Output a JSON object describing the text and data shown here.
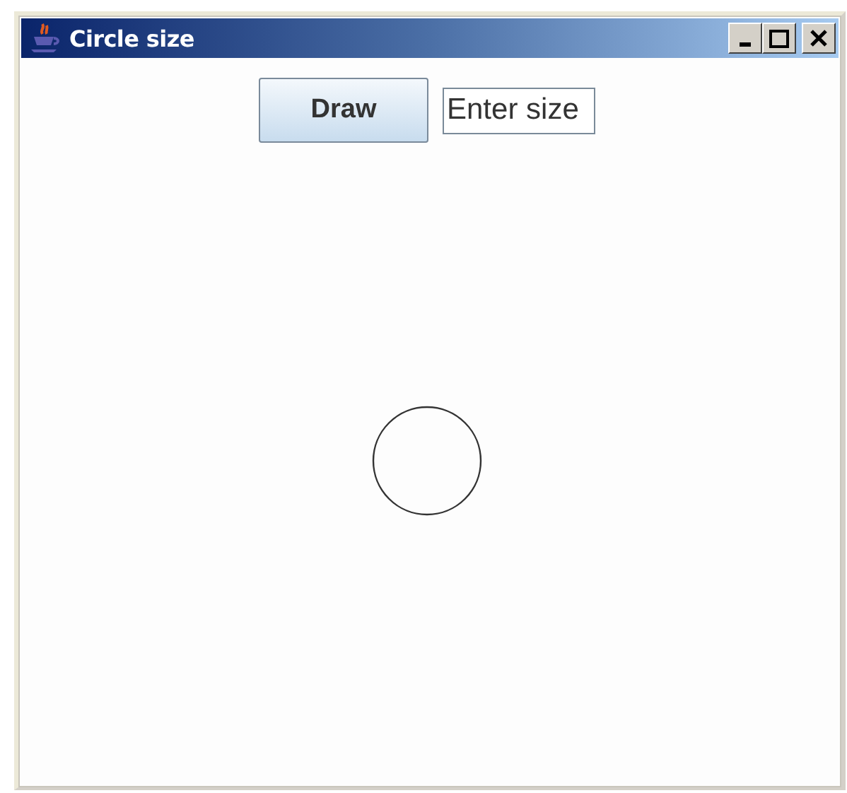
{
  "window": {
    "title": "Circle size"
  },
  "toolbar": {
    "button": "Draw",
    "field": {
      "value": "Enter size"
    }
  }
}
